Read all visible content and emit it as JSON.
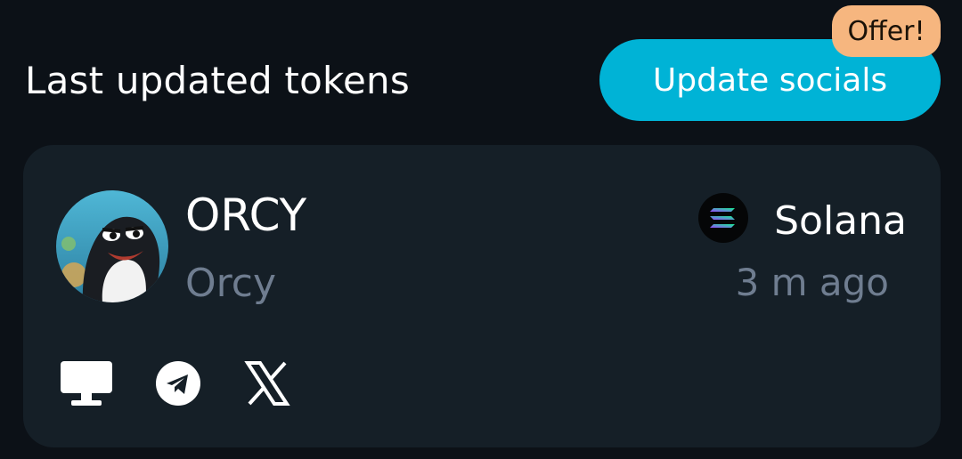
{
  "header": {
    "title": "Last updated tokens",
    "update_button_label": "Update socials",
    "offer_badge": "Offer!"
  },
  "token": {
    "symbol": "ORCY",
    "name": "Orcy",
    "chain": "Solana",
    "updated": "3 m ago",
    "avatar_icon": "orca-avatar",
    "chain_icon": "solana-icon",
    "socials": [
      {
        "type": "website",
        "icon": "desktop-icon"
      },
      {
        "type": "telegram",
        "icon": "telegram-icon"
      },
      {
        "type": "x",
        "icon": "x-icon"
      }
    ]
  },
  "colors": {
    "background": "#0c1117",
    "card": "#151f27",
    "accent": "#00b3d6",
    "badge": "#f6b67f",
    "muted_text": "#6f7d90"
  }
}
